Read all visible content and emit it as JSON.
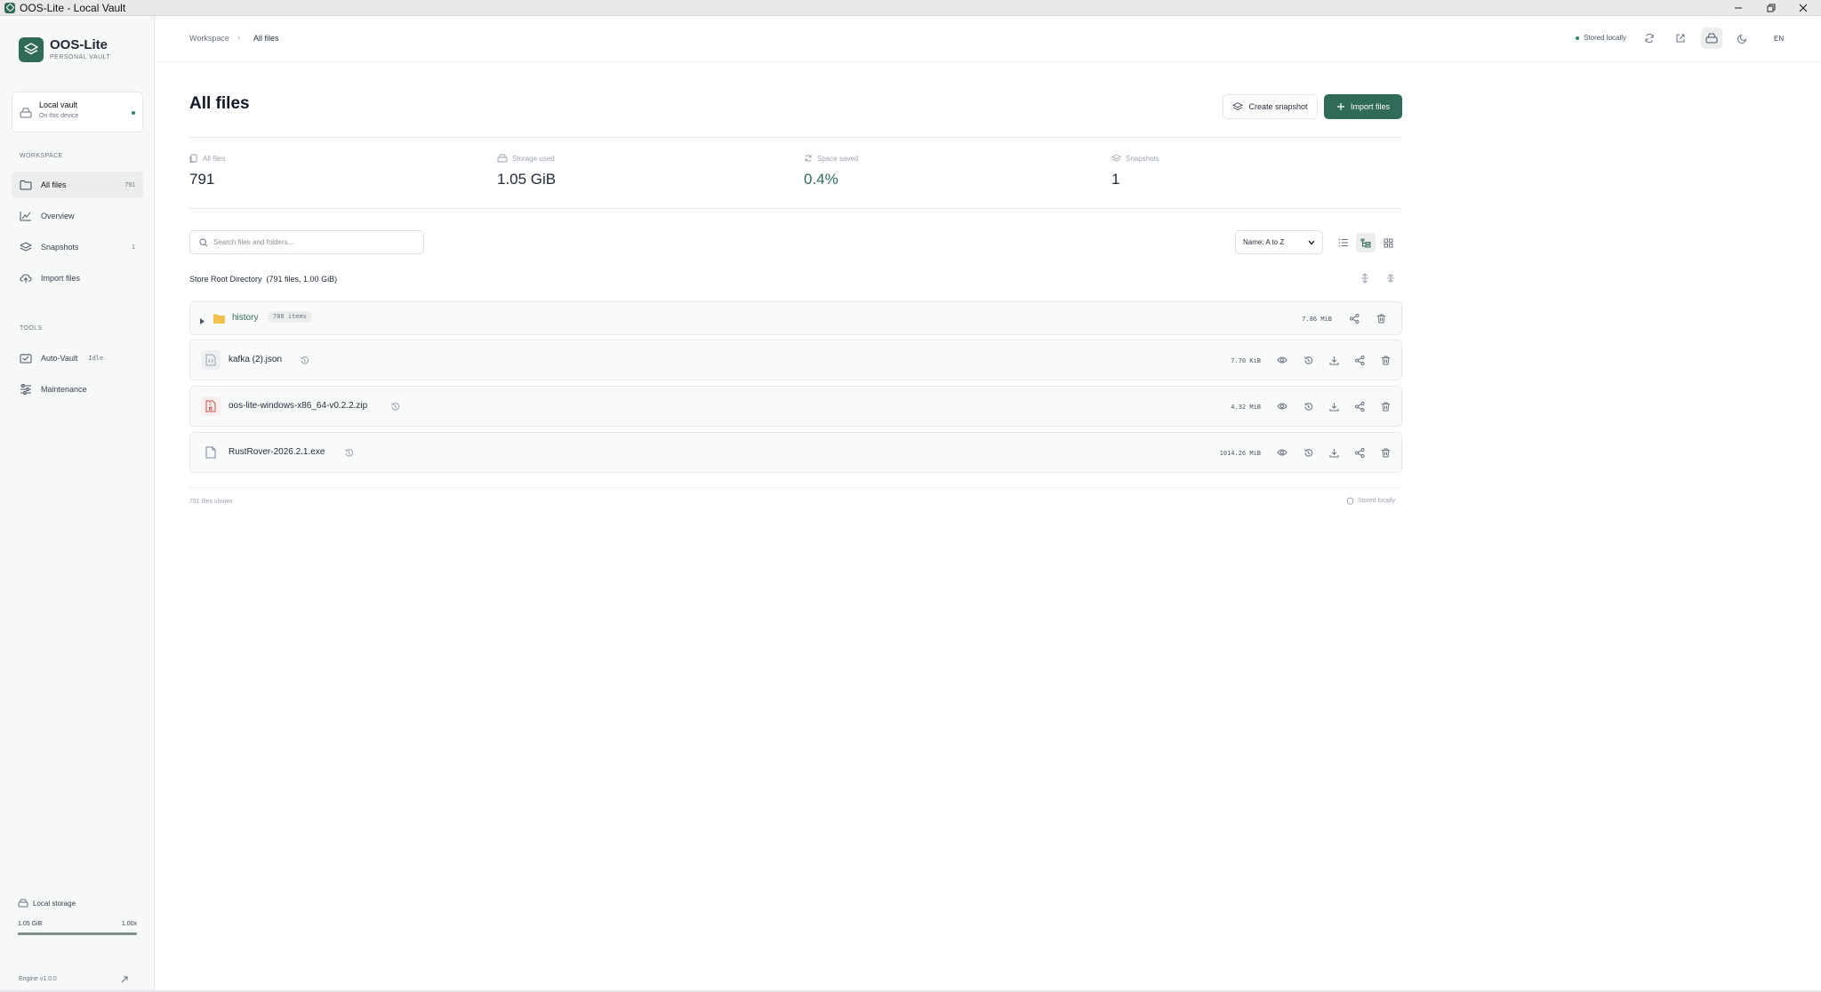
{
  "window": {
    "title": "OOS-Lite - Local Vault",
    "controls": [
      "minimize",
      "restore",
      "close"
    ]
  },
  "brand": {
    "name": "OOS-Lite",
    "subtitle": "PERSONAL VAULT"
  },
  "vault": {
    "title": "Local vault",
    "subtitle": "On this device",
    "status_color": "#2f8a66"
  },
  "sidebar": {
    "workspace_label": "WORKSPACE",
    "workspace_items": [
      {
        "label": "All files",
        "count": "791",
        "icon": "folder-icon",
        "active": true
      },
      {
        "label": "Overview",
        "count": "",
        "icon": "chart-icon",
        "active": false
      },
      {
        "label": "Snapshots",
        "count": "1",
        "icon": "layers-icon",
        "active": false
      },
      {
        "label": "Import files",
        "count": "",
        "icon": "cloud-upload-icon",
        "active": false
      }
    ],
    "tools_label": "TOOLS",
    "tools_items": [
      {
        "label": "Auto-Vault",
        "badge": "Idle",
        "icon": "auto-vault-icon"
      },
      {
        "label": "Maintenance",
        "icon": "sliders-icon"
      }
    ],
    "storage": {
      "label": "Local storage",
      "used": "1.05 GiB",
      "ratio": "1.00x",
      "fill_fraction": 1.0
    },
    "engine": "Engine v1.0.0"
  },
  "header": {
    "breadcrumb": [
      "Workspace",
      "All files"
    ],
    "status": "Stored locally",
    "icons": [
      "refresh-icon",
      "external-link-icon",
      "drive-icon",
      "moon-icon"
    ],
    "language": "EN"
  },
  "main": {
    "title": "All files",
    "create_snapshot_label": "Create snapshot",
    "import_label": "Import files",
    "stats": [
      {
        "label": "All files",
        "value": "791",
        "icon": "files-icon"
      },
      {
        "label": "Storage used",
        "value": "1.05 GiB",
        "icon": "drive-icon"
      },
      {
        "label": "Space saved",
        "value": "0.4%",
        "icon": "recycle-icon"
      },
      {
        "label": "Snapshots",
        "value": "1",
        "icon": "layers-icon"
      }
    ],
    "search_placeholder": "Search files and folders...",
    "sort_selected": "Name: A to Z",
    "directory_label": "Store Root Directory  (791 files, 1.00 GiB)",
    "rows": [
      {
        "type": "folder",
        "name": "history",
        "badge": "788 items",
        "size": "7.86 MiB"
      },
      {
        "type": "file",
        "name": "kafka (2).json",
        "size": "7.70 KiB",
        "icon": "json-file-icon"
      },
      {
        "type": "file",
        "name": "oos-lite-windows-x86_64-v0.2.2.zip",
        "size": "4.32 MiB",
        "icon": "zip-file-icon"
      },
      {
        "type": "file",
        "name": "RustRover-2026.2.1.exe",
        "size": "1014.26 MiB",
        "icon": "file-icon"
      }
    ],
    "footer_left": "791 files shown",
    "footer_right": "Stored locally"
  },
  "colors": {
    "accent": "#2f6b55",
    "sidebar_bg": "#f7f8f8",
    "row_bg": "#f9fafa",
    "folder": "#f2c14e",
    "zip": "#c0504d"
  }
}
